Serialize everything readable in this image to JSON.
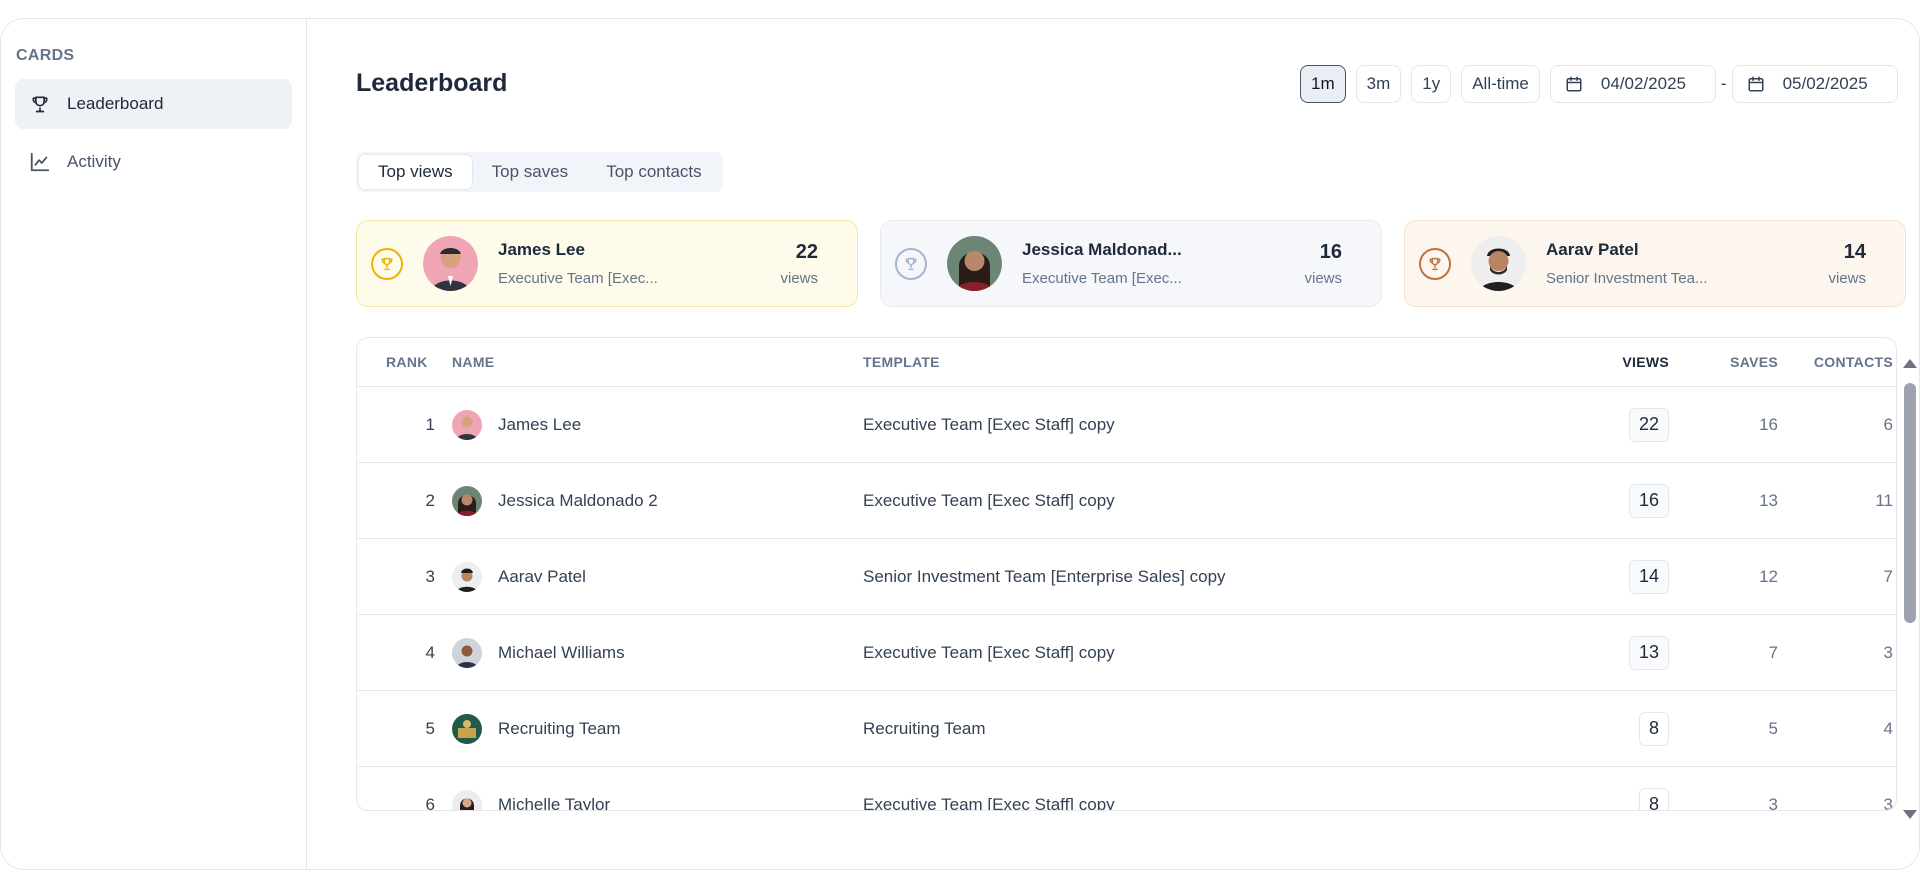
{
  "sidebar": {
    "title": "CARDS",
    "items": [
      {
        "label": "Leaderboard",
        "icon": "trophy-icon",
        "active": true
      },
      {
        "label": "Activity",
        "icon": "line-chart-icon",
        "active": false
      }
    ]
  },
  "header": {
    "title": "Leaderboard",
    "ranges": [
      "1m",
      "3m",
      "1y",
      "All-time"
    ],
    "active_range": "1m",
    "date_from": "04/02/2025",
    "date_separator": "-",
    "date_to": "05/02/2025"
  },
  "tabs": [
    {
      "label": "Top views",
      "active": true
    },
    {
      "label": "Top saves",
      "active": false
    },
    {
      "label": "Top contacts",
      "active": false
    }
  ],
  "top_cards": [
    {
      "name": "James Lee",
      "subtitle": "Executive Team [Exec...",
      "value": "22",
      "unit": "views",
      "medal": "gold"
    },
    {
      "name": "Jessica Maldonad...",
      "subtitle": "Executive Team [Exec...",
      "value": "16",
      "unit": "views",
      "medal": "silver"
    },
    {
      "name": "Aarav Patel",
      "subtitle": "Senior Investment Tea...",
      "value": "14",
      "unit": "views",
      "medal": "bronze"
    }
  ],
  "table": {
    "headers": {
      "rank": "RANK",
      "name": "NAME",
      "template": "TEMPLATE",
      "views": "VIEWS",
      "saves": "SAVES",
      "contacts": "CONTACTS"
    },
    "rows": [
      {
        "rank": "1",
        "name": "James Lee",
        "template": "Executive Team [Exec Staff] copy",
        "views": "22",
        "saves": "16",
        "contacts": "6"
      },
      {
        "rank": "2",
        "name": "Jessica Maldonado 2",
        "template": "Executive Team [Exec Staff] copy",
        "views": "16",
        "saves": "13",
        "contacts": "11"
      },
      {
        "rank": "3",
        "name": "Aarav Patel",
        "template": "Senior Investment Team [Enterprise Sales] copy",
        "views": "14",
        "saves": "12",
        "contacts": "7"
      },
      {
        "rank": "4",
        "name": "Michael Williams",
        "template": "Executive Team [Exec Staff] copy",
        "views": "13",
        "saves": "7",
        "contacts": "3"
      },
      {
        "rank": "5",
        "name": "Recruiting Team",
        "template": "Recruiting Team",
        "views": "8",
        "saves": "5",
        "contacts": "4"
      },
      {
        "rank": "6",
        "name": "Michelle Taylor",
        "template": "Executive Team [Exec Staff] copy",
        "views": "8",
        "saves": "3",
        "contacts": "3"
      }
    ]
  },
  "colors": {
    "accent": "#1e293b",
    "gold": "#eab308",
    "silver": "#a5b4cf",
    "bronze": "#c2703d"
  }
}
